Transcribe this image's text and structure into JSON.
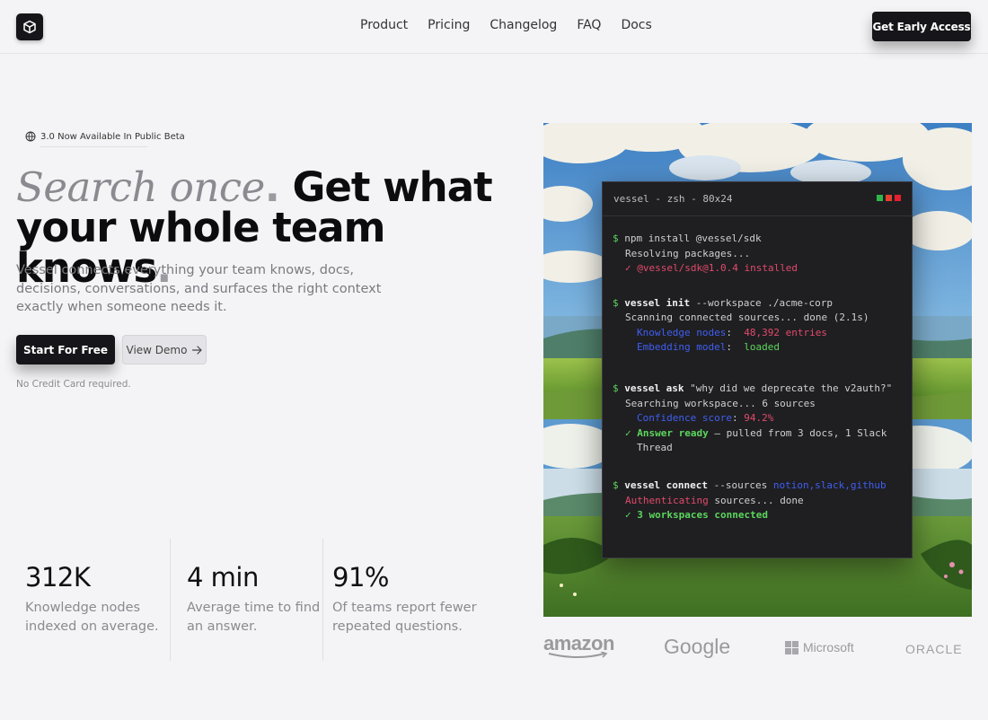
{
  "nav": {
    "links": [
      "Product",
      "Pricing",
      "Changelog",
      "FAQ",
      "Docs"
    ],
    "cta_label": "Get Early Access"
  },
  "hero": {
    "badge": "3.0 Now Available In Public Beta",
    "headline_serif": "Search once",
    "headline_dot1": ".",
    "headline_main": " Get what your whole team knows",
    "headline_dot2": ".",
    "subtext": "Vessel connects everything your team knows, docs, decisions, conversations, and surfaces the right context exactly when someone needs it.",
    "primary_button": "Start For Free",
    "secondary_button": "View Demo",
    "note": "No Credit Card required."
  },
  "stats": [
    {
      "value": "312K",
      "desc_1": "Knowledge nodes",
      "desc_2": "indexed on average."
    },
    {
      "value": "4 min",
      "desc_1": "Average time to find",
      "desc_2": "an answer."
    },
    {
      "value": "91%",
      "desc_1": "Of teams report fewer",
      "desc_2": "repeated questions."
    }
  ],
  "terminal": {
    "title": "vessel - zsh - 80x24",
    "dot_colors": [
      "#2fb84a",
      "#e5412f",
      "#e51f2f"
    ],
    "l1_prompt": "$",
    "l1_cmd": " npm install @vessel/sdk",
    "l2": "Resolving packages...",
    "l3_check": "✓",
    "l3_text": " @vessel/sdk@1.0.4 installed",
    "l4_prompt": "$",
    "l4_cmd": " vessel init",
    "l4_rest": " --workspace ./acme-corp",
    "l5": "Scanning connected sources... done (2.1s)",
    "l6_key": "Knowledge nodes",
    "l6_sep": ":  ",
    "l6_val": "48,392 entries",
    "l7_key": "Embedding model",
    "l7_sep": ":  ",
    "l7_val": "loaded",
    "l8_prompt": "$",
    "l8_cmd": " vessel ask",
    "l8_rest": " \"why did we deprecate the v2auth?\"",
    "l9": "Searching workspace... 6 sources",
    "l10_key": "Confidence score",
    "l10_sep": ": ",
    "l10_val": "94.2%",
    "l11_check": "✓",
    "l11_key": " Answer ready",
    "l11_rest": " — pulled from 3 docs, 1 Slack",
    "l12": "Thread",
    "l13_prompt": "$",
    "l13_cmd": " vessel connect",
    "l13_rest": " --sources ",
    "l13_val": "notion,slack,github",
    "l14_key": "Authenticating",
    "l14_rest": " sources... done",
    "l15_check": "✓",
    "l15_text": " 3 workspaces connected"
  },
  "logos": [
    "amazon",
    "Google",
    "Microsoft",
    "ORACLE"
  ]
}
